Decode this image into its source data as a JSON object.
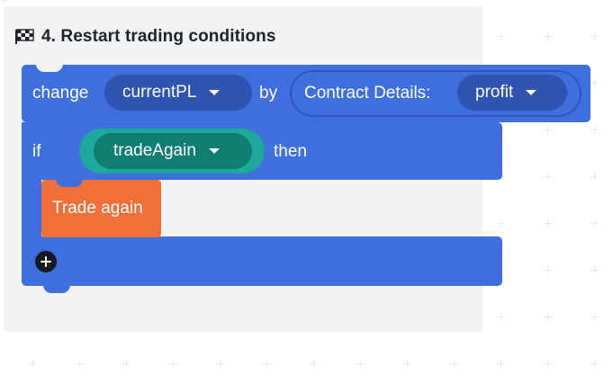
{
  "group": {
    "title": "4. Restart trading conditions",
    "icon": "checkered-flag-icon"
  },
  "change_block": {
    "keyword": "change",
    "variable": "currentPL",
    "by_label": "by",
    "reporter_label": "Contract Details:",
    "reporter_value": "profit"
  },
  "if_block": {
    "if_label": "if",
    "condition_variable": "tradeAgain",
    "then_label": "then",
    "inner_block_label": "Trade again",
    "add_icon": "plus-circle-icon"
  },
  "colors": {
    "block_blue": "#3f6fdc",
    "dropdown_blue": "#2f53b0",
    "condition_teal": "#1ca89a",
    "condition_teal_dark": "#107d73",
    "trade_again_orange": "#f07038",
    "panel_bg": "#f2f3f5"
  }
}
